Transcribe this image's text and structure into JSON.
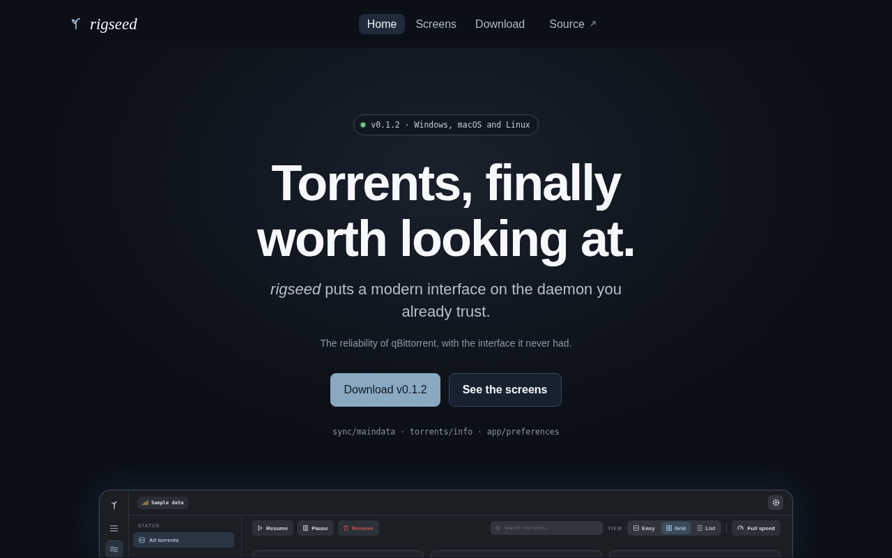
{
  "nav": {
    "brand": "rigseed",
    "links": [
      {
        "label": "Home",
        "selected": true,
        "external": false
      },
      {
        "label": "Screens",
        "selected": false,
        "external": false
      },
      {
        "label": "Download",
        "selected": false,
        "external": false
      },
      {
        "label": "Source",
        "selected": false,
        "external": true
      }
    ]
  },
  "hero": {
    "badge": "v0.1.2 · Windows, macOS and Linux",
    "title": "Torrents, finally worth looking at.",
    "subtitle": "*rigseed* puts a modern interface on the daemon you already trust.",
    "tagline": "The reliability of qBittorrent, with the interface it never had.",
    "buttons": [
      {
        "label": "Download v0.1.2",
        "kind": "primary"
      },
      {
        "label": "See the screens",
        "kind": "secondary"
      }
    ],
    "endpoints": "sync/maindata · torrents/info · app/preferences"
  },
  "preview": {
    "rail": [
      {
        "kind": "menu",
        "selected": false
      },
      {
        "kind": "waves",
        "selected": true
      }
    ],
    "chip": "Sample data",
    "sidebar": {
      "heading": "STATUS",
      "items": [
        {
          "label": "All torrents",
          "selected": true
        }
      ]
    },
    "actions": [
      {
        "label": "Resume",
        "kind": "play"
      },
      {
        "label": "Pause",
        "kind": "pause"
      },
      {
        "label": "Remove",
        "kind": "remove"
      }
    ],
    "search": {
      "placeholder": "Search torrents…"
    },
    "view_label": "VIEW",
    "views": [
      {
        "label": "Easy",
        "kind": "rows",
        "selected": false
      },
      {
        "label": "Grid",
        "kind": "grid",
        "selected": true
      },
      {
        "label": "List",
        "kind": "list",
        "selected": false
      }
    ],
    "speed_button": "Full speed",
    "cards": [
      {
        "kind": "torrent"
      },
      {
        "kind": "torrent"
      },
      {
        "kind": "torrent"
      }
    ]
  }
}
